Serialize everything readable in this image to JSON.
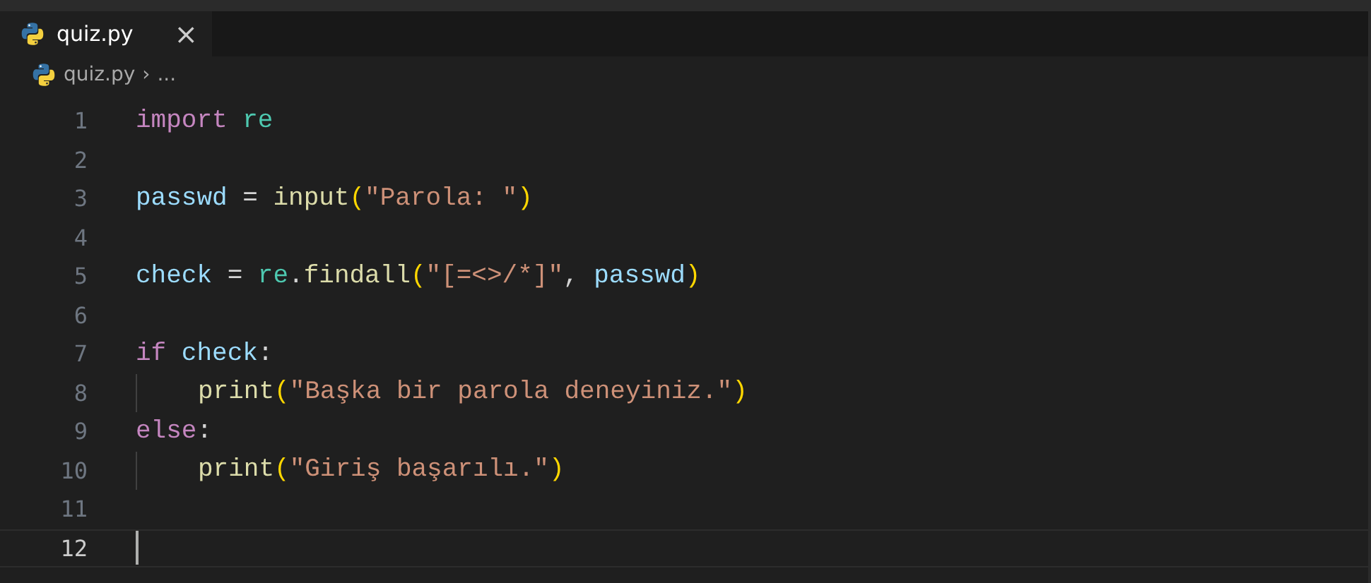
{
  "tabs": [
    {
      "label": "quiz.py",
      "selected": true,
      "close": "×"
    }
  ],
  "breadcrumb": {
    "file": "quiz.py",
    "separator": "›",
    "more": "..."
  },
  "lines": [
    {
      "number": "1",
      "current": false,
      "tokens": [
        {
          "kind": "keyword",
          "text": "import"
        },
        {
          "kind": "module",
          "text": " re"
        }
      ]
    },
    {
      "number": "2",
      "current": false
    },
    {
      "number": "3",
      "current": false,
      "tokens": [
        {
          "kind": "variable",
          "text": "passwd"
        },
        {
          "kind": "plain",
          "text": " = "
        },
        {
          "kind": "function",
          "text": "input"
        },
        {
          "kind": "bracket",
          "text": "("
        },
        {
          "kind": "string",
          "text": "\"Parola: \""
        },
        {
          "kind": "bracket",
          "text": ")"
        }
      ]
    },
    {
      "number": "4",
      "current": false
    },
    {
      "number": "5",
      "current": false,
      "tokens": [
        {
          "kind": "variable",
          "text": "check"
        },
        {
          "kind": "plain",
          "text": " = "
        },
        {
          "kind": "module",
          "text": "re"
        },
        {
          "kind": "plain",
          "text": "."
        },
        {
          "kind": "function",
          "text": "findall"
        },
        {
          "kind": "bracket",
          "text": "("
        },
        {
          "kind": "string",
          "text": "\"[=<>/*]\""
        },
        {
          "kind": "plain",
          "text": ", "
        },
        {
          "kind": "variable",
          "text": "passwd"
        },
        {
          "kind": "bracket",
          "text": ")"
        }
      ]
    },
    {
      "number": "6",
      "current": false
    },
    {
      "number": "7",
      "current": false,
      "tokens": [
        {
          "kind": "keyword",
          "text": "if"
        },
        {
          "kind": "variable",
          "text": " check"
        },
        {
          "kind": "plain",
          "text": ":"
        }
      ]
    },
    {
      "number": "8",
      "current": false,
      "indented": true,
      "tokens": [
        {
          "kind": "function",
          "text": "print"
        },
        {
          "kind": "bracket",
          "text": "("
        },
        {
          "kind": "string",
          "text": "\"Başka bir parola deneyiniz.\""
        },
        {
          "kind": "bracket",
          "text": ")"
        }
      ]
    },
    {
      "number": "9",
      "current": false,
      "tokens": [
        {
          "kind": "keyword",
          "text": "else"
        },
        {
          "kind": "plain",
          "text": ":"
        }
      ]
    },
    {
      "number": "10",
      "current": false,
      "indented": true,
      "tokens": [
        {
          "kind": "function",
          "text": "print"
        },
        {
          "kind": "bracket",
          "text": "("
        },
        {
          "kind": "string",
          "text": "\"Giriş başarılı.\""
        },
        {
          "kind": "bracket",
          "text": ")"
        }
      ]
    },
    {
      "number": "11",
      "current": false
    },
    {
      "number": "12",
      "current": true
    }
  ]
}
